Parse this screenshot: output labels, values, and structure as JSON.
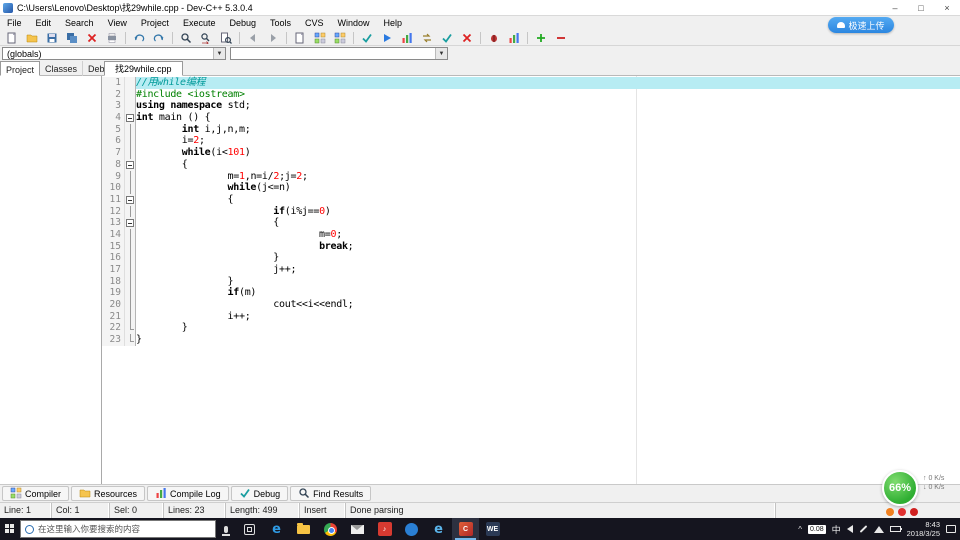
{
  "window": {
    "title": "C:\\Users\\Lenovo\\Desktop\\找29while.cpp - Dev-C++ 5.3.0.4",
    "minimize": "–",
    "maximize": "□",
    "close": "×"
  },
  "menu": {
    "items": [
      "File",
      "Edit",
      "Search",
      "View",
      "Project",
      "Execute",
      "Debug",
      "Tools",
      "CVS",
      "Window",
      "Help"
    ]
  },
  "toolbar": {
    "upload_badge": "极速上传",
    "groups": [
      [
        "new-file",
        "open-file",
        "save",
        "save-all",
        "close-file",
        "print"
      ],
      [
        "undo",
        "redo"
      ],
      [
        "find",
        "replace",
        "find-in-files"
      ],
      [
        "goto-back",
        "goto-forward"
      ],
      [
        "new-unit",
        "insert-snippet",
        "toggle-bookmark"
      ],
      [
        "compile",
        "run",
        "compile-and-run",
        "rebuild",
        "syntax-check",
        "stop-execution"
      ],
      [
        "debug",
        "profile"
      ],
      [
        "add-to-project",
        "remove-from-project"
      ]
    ]
  },
  "navigator": {
    "globals": "(globals)",
    "members": ""
  },
  "sidebar": {
    "tabs": [
      "Project",
      "Classes",
      "Debug"
    ],
    "selected": "Project"
  },
  "editor": {
    "tab": "找29while.cpp",
    "fold": [
      "none",
      "none",
      "none",
      "box",
      "line",
      "line",
      "line",
      "box",
      "line",
      "line",
      "box",
      "line",
      "box",
      "line",
      "line",
      "line",
      "line",
      "line",
      "line",
      "line",
      "line",
      "end",
      "end"
    ],
    "lines": [
      [
        [
          "cm",
          "//用while编程"
        ]
      ],
      [
        [
          "pp",
          "#include <iostream>"
        ]
      ],
      [
        [
          "kw",
          "using"
        ],
        [
          "pl",
          " "
        ],
        [
          "kw",
          "namespace"
        ],
        [
          "pl",
          " std;"
        ]
      ],
      [
        [
          "kw",
          "int"
        ],
        [
          "pl",
          " main () {"
        ]
      ],
      [
        [
          "pl",
          "        "
        ],
        [
          "kw",
          "int"
        ],
        [
          "pl",
          " i,j,n,m;"
        ]
      ],
      [
        [
          "pl",
          "        i="
        ],
        [
          "num",
          "2"
        ],
        [
          "pl",
          ";"
        ]
      ],
      [
        [
          "pl",
          "        "
        ],
        [
          "kw",
          "while"
        ],
        [
          "pl",
          "(i<"
        ],
        [
          "num",
          "101"
        ],
        [
          "pl",
          ")"
        ]
      ],
      [
        [
          "pl",
          "        {"
        ]
      ],
      [
        [
          "pl",
          "                m="
        ],
        [
          "num",
          "1"
        ],
        [
          "pl",
          ",n=i/"
        ],
        [
          "num",
          "2"
        ],
        [
          "pl",
          ";j="
        ],
        [
          "num",
          "2"
        ],
        [
          "pl",
          ";"
        ]
      ],
      [
        [
          "pl",
          "                "
        ],
        [
          "kw",
          "while"
        ],
        [
          "pl",
          "(j<=n)"
        ]
      ],
      [
        [
          "pl",
          "                {"
        ]
      ],
      [
        [
          "pl",
          "                        "
        ],
        [
          "kw",
          "if"
        ],
        [
          "pl",
          "(i%j=="
        ],
        [
          "num",
          "0"
        ],
        [
          "pl",
          ")"
        ]
      ],
      [
        [
          "pl",
          "                        {"
        ]
      ],
      [
        [
          "pl",
          "                                m="
        ],
        [
          "num",
          "0"
        ],
        [
          "pl",
          ";"
        ]
      ],
      [
        [
          "pl",
          "                                "
        ],
        [
          "kw",
          "break"
        ],
        [
          "pl",
          ";"
        ]
      ],
      [
        [
          "pl",
          "                        }"
        ]
      ],
      [
        [
          "pl",
          "                        j++;"
        ]
      ],
      [
        [
          "pl",
          "                }"
        ]
      ],
      [
        [
          "pl",
          "                "
        ],
        [
          "kw",
          "if"
        ],
        [
          "pl",
          "(m)"
        ]
      ],
      [
        [
          "pl",
          "                        cout<<i<<endl;"
        ]
      ],
      [
        [
          "pl",
          "                i++;"
        ]
      ],
      [
        [
          "pl",
          "        }"
        ]
      ],
      [
        [
          "pl",
          "}"
        ]
      ]
    ]
  },
  "bottom_tabs": [
    {
      "label": "Compiler",
      "icon": "compiler-icon"
    },
    {
      "label": "Resources",
      "icon": "resources-icon"
    },
    {
      "label": "Compile Log",
      "icon": "compile-log-icon"
    },
    {
      "label": "Debug",
      "icon": "debug-icon"
    },
    {
      "label": "Find Results",
      "icon": "find-results-icon"
    }
  ],
  "statusbar": {
    "segments": [
      "Line: 1",
      "Col: 1",
      "Sel: 0",
      "Lines: 23",
      "Length: 499",
      "Insert",
      "Done parsing"
    ]
  },
  "overlay": {
    "percent": "66%",
    "upload_speed": "↑ 0 K/s",
    "download_speed": "↓ 0 K/s"
  },
  "taskbar": {
    "search_placeholder": "在这里输入你要搜索的内容",
    "apps": [
      "task-view",
      "edge",
      "file-explorer",
      "chrome",
      "mail",
      "netease-music",
      "qq",
      "ie",
      "dev-cpp",
      "wegame"
    ],
    "active_app": "dev-cpp",
    "tray": {
      "cpu_badge": "0.08",
      "ime": "中",
      "time": "8:43",
      "date": "2018/3/25"
    }
  }
}
